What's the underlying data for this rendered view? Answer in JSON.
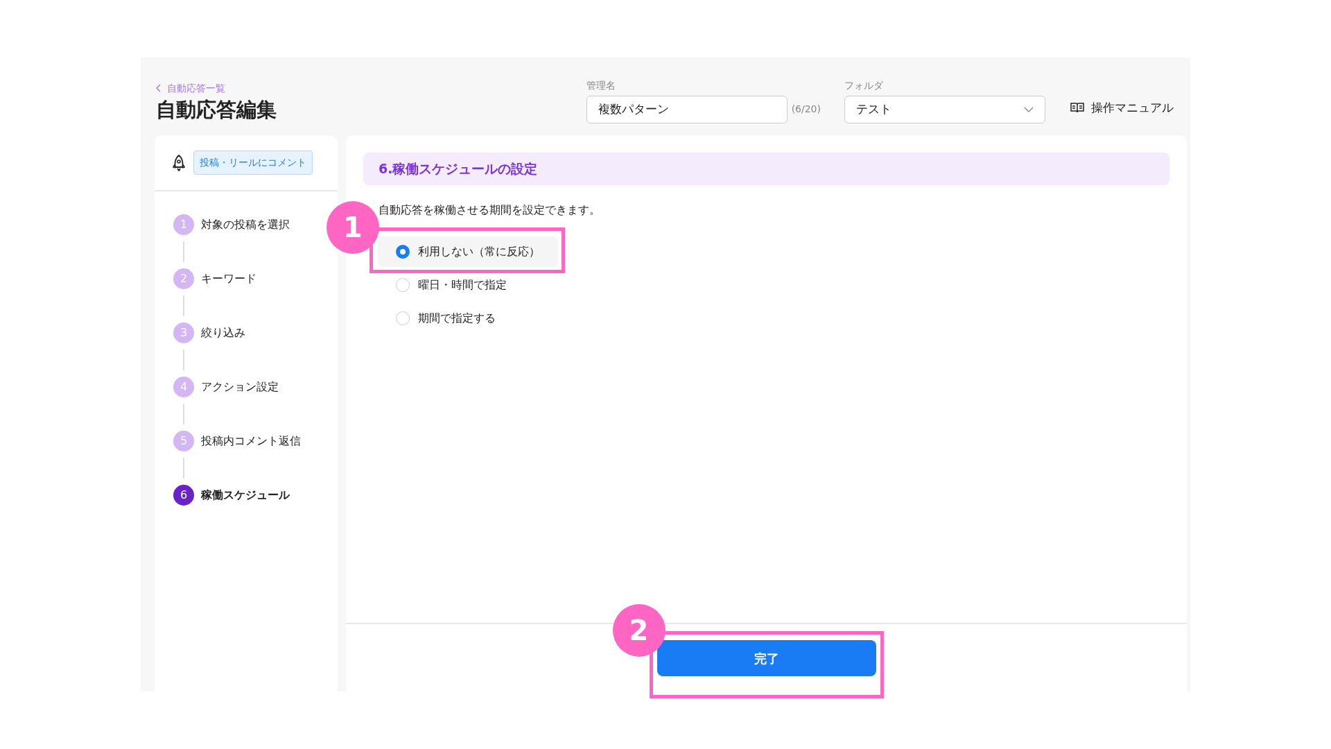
{
  "breadcrumb": {
    "label": "自動応答一覧"
  },
  "page_title": "自動応答編集",
  "name_field": {
    "label": "管理名",
    "value": "複数パターン",
    "counter": "(6/20)"
  },
  "folder_select": {
    "label": "フォルダ",
    "value": "テスト"
  },
  "manual_link": {
    "label": "操作マニュアル"
  },
  "sidebar": {
    "trigger_tag": "投稿・リールにコメント",
    "steps": [
      {
        "number": "1",
        "label": "対象の投稿を選択",
        "selected": false
      },
      {
        "number": "2",
        "label": "キーワード",
        "selected": false
      },
      {
        "number": "3",
        "label": "絞り込み",
        "selected": false
      },
      {
        "number": "4",
        "label": "アクション設定",
        "selected": false
      },
      {
        "number": "5",
        "label": "投稿内コメント返信",
        "selected": false
      },
      {
        "number": "6",
        "label": "稼働スケジュール",
        "selected": true
      }
    ]
  },
  "section": {
    "title": "6.稼働スケジュールの設定",
    "description": "自動応答を稼働させる期間を設定できます。",
    "options": [
      {
        "label": "利用しない（常に反応）",
        "selected": true,
        "annotation": "1"
      },
      {
        "label": "曜日・時間で指定",
        "selected": false
      },
      {
        "label": "期間で指定する",
        "selected": false
      }
    ]
  },
  "footer": {
    "button": "完了",
    "annotation": "2"
  }
}
